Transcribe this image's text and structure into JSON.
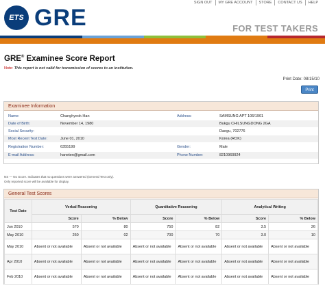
{
  "header": {
    "ets_badge": "ETS",
    "gre_wordmark": "GRE",
    "tagline": "FOR TEST TAKERS",
    "nav": [
      "SIGN OUT",
      "MY GRE ACCOUNT",
      "STORE",
      "CONTACT US",
      "HELP"
    ],
    "bar_colors": [
      "#0a3d7a",
      "#6aa2d8",
      "#8fbf3a",
      "#e07b12",
      "#b7282e"
    ]
  },
  "report": {
    "title": "GRE",
    "title_reg": "®",
    "title_rest": " Examinee Score Report",
    "note_label": "Note:",
    "note_text": "This report is not valid for transmission of scores to an institution.",
    "print_date": "Print Date: 08/15/10",
    "print_button": "Print"
  },
  "examinee": {
    "heading": "Examinee Information",
    "rows": [
      {
        "l1": "Name:",
        "v1": "Changhyeok Han",
        "l2": "Address:",
        "v2": "SAMSUNG APT 106/1901"
      },
      {
        "l1": "Date of Birth:",
        "v1": "November 14, 1980",
        "l2": "",
        "v2": "Bukgu CHILSUNGDONG 2GA"
      },
      {
        "l1": "Social Security:",
        "v1": "",
        "l2": "",
        "v2": "Daegu, 702776"
      },
      {
        "l1": "Most Recent Test Date:",
        "v1": "June 01, 2010",
        "l2": "",
        "v2": "Korea (ROK)"
      },
      {
        "l1": "Registration Number:",
        "v1": "6355199",
        "l2": "Gender:",
        "v2": "Male"
      },
      {
        "l1": "E-mail Address:",
        "v1": "haneten@gmail.com",
        "l2": "Phone Number:",
        "v2": "8210969924"
      }
    ],
    "footnote1": "NS — No Score. Indicates that no questions were answered (General Test only).",
    "footnote2": "Only reported score will be available for display."
  },
  "scores": {
    "heading": "General Test Scores",
    "col_test_date": "Test Date",
    "col_verbal": "Verbal Reasoning",
    "col_quant": "Quantitative Reasoning",
    "col_writing": "Analytical Writing",
    "sub_score": "Score",
    "sub_below": "% Below",
    "rows": [
      {
        "date": "Jun 2010",
        "vs": "570",
        "vb": "80",
        "qs": "750",
        "qb": "82",
        "ws": "3.5",
        "wb": "26"
      },
      {
        "date": "May 2010",
        "vs": "260",
        "vb": "02",
        "qs": "700",
        "qb": "70",
        "ws": "3.0",
        "wb": "10"
      },
      {
        "date": "May 2010",
        "vs": "Absent or not available",
        "vb": "Absent or not available",
        "qs": "Absent or not available",
        "qb": "Absent or not available",
        "ws": "Absent or not available",
        "wb": "Absent or not available"
      },
      {
        "date": "Apr 2010",
        "vs": "Absent or not available",
        "vb": "Absent or not available",
        "qs": "Absent or not available",
        "qb": "Absent or not available",
        "ws": "Absent or not available",
        "wb": "Absent or not available"
      },
      {
        "date": "Feb 2010",
        "vs": "Absent or not available",
        "vb": "Absent or not available",
        "qs": "Absent or not available",
        "qb": "Absent or not available",
        "ws": "Absent or not available",
        "wb": "Absent or not available"
      }
    ]
  }
}
